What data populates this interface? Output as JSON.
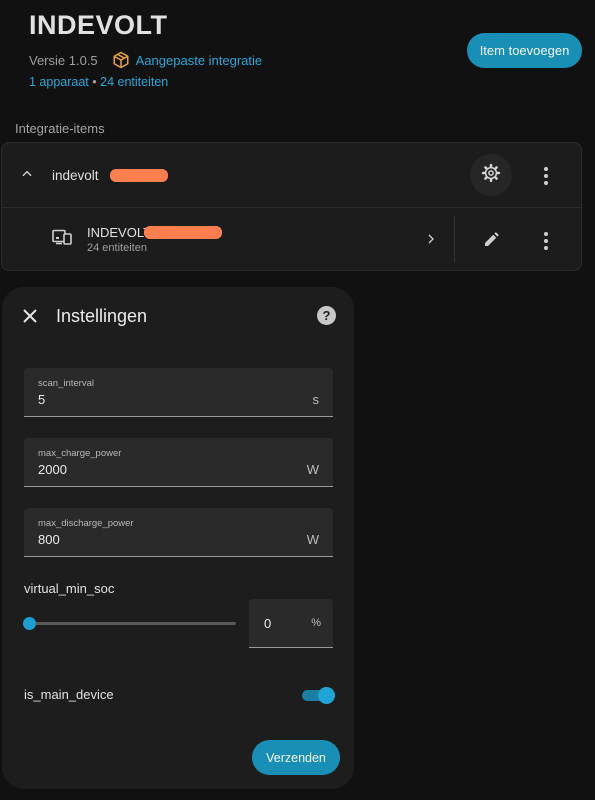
{
  "header": {
    "title": "INDEVOLT",
    "version": "Versie 1.0.5",
    "custom_integration_link": "Aangepaste integratie",
    "devices_link": "1 apparaat",
    "separator": "•",
    "entities_link": "24 entiteiten",
    "add_button": "Item toevoegen"
  },
  "section_label": "Integratie-items",
  "entry": {
    "name": "indevolt",
    "device": {
      "name": "INDEVOLT",
      "subtitle": "24 entiteiten"
    }
  },
  "dialog": {
    "title": "Instellingen",
    "help_icon": "?",
    "fields": [
      {
        "label": "scan_interval",
        "value": "5",
        "unit": "s"
      },
      {
        "label": "max_charge_power",
        "value": "2000",
        "unit": "W"
      },
      {
        "label": "max_discharge_power",
        "value": "800",
        "unit": "W"
      }
    ],
    "virtual_min_soc": {
      "label": "virtual_min_soc",
      "value": "0",
      "unit": "%",
      "slider_fraction": 0
    },
    "is_main_device": {
      "label": "is_main_device",
      "checked": true
    },
    "submit_button": "Verzenden"
  },
  "colors": {
    "accent": "#1a8fb5",
    "link": "#2aa7d8",
    "redaction": "#ff7f50",
    "package_icon": "#e8a33a"
  },
  "icons": {
    "package": "package-icon",
    "chevron_up": "chevron-up-icon",
    "gear": "gear-icon",
    "more": "more-vertical-icon",
    "device": "devices-icon",
    "chevron_right": "chevron-right-icon",
    "pencil": "pencil-icon",
    "close": "close-icon",
    "help": "help-circle-icon"
  }
}
